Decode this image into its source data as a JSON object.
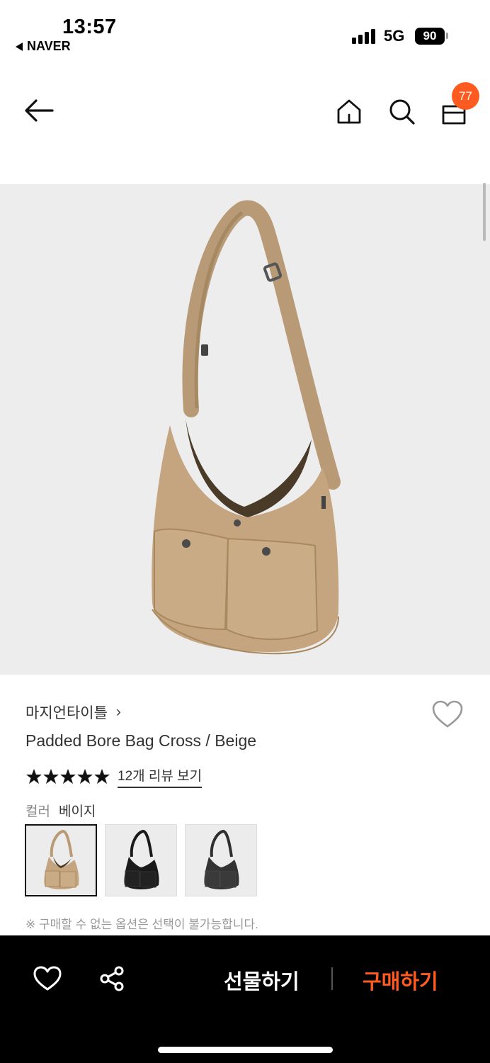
{
  "status_bar": {
    "time": "13:57",
    "back_app": "NAVER",
    "network": "5G",
    "battery": "90"
  },
  "header": {
    "back_icon": "arrow-left-icon",
    "home_icon": "home-icon",
    "search_icon": "search-icon",
    "cart_icon": "shopping-bag-icon",
    "cart_count": "77"
  },
  "product": {
    "brand": "마지언타이틀",
    "brand_chevron": "›",
    "name": "Padded Bore Bag Cross / Beige",
    "rating_stars": 5,
    "review_link": "12개 리뷰 보기",
    "color_label": "컬러",
    "color_value": "베이지",
    "swatches": [
      {
        "color": "#c4a57f",
        "label": "beige",
        "selected": true
      },
      {
        "color": "#1a1a1a",
        "label": "black",
        "selected": false
      },
      {
        "color": "#2f2f2f",
        "label": "charcoal",
        "selected": false
      }
    ],
    "notice": "※ 구매할 수 없는 옵션은 선택이 불가능합니다."
  },
  "bottom_bar": {
    "like_icon": "heart-icon",
    "share_icon": "share-icon",
    "gift_label": "선물하기",
    "buy_label": "구매하기"
  },
  "colors": {
    "accent": "#ff5a1f",
    "bag": "#c4a57f"
  }
}
